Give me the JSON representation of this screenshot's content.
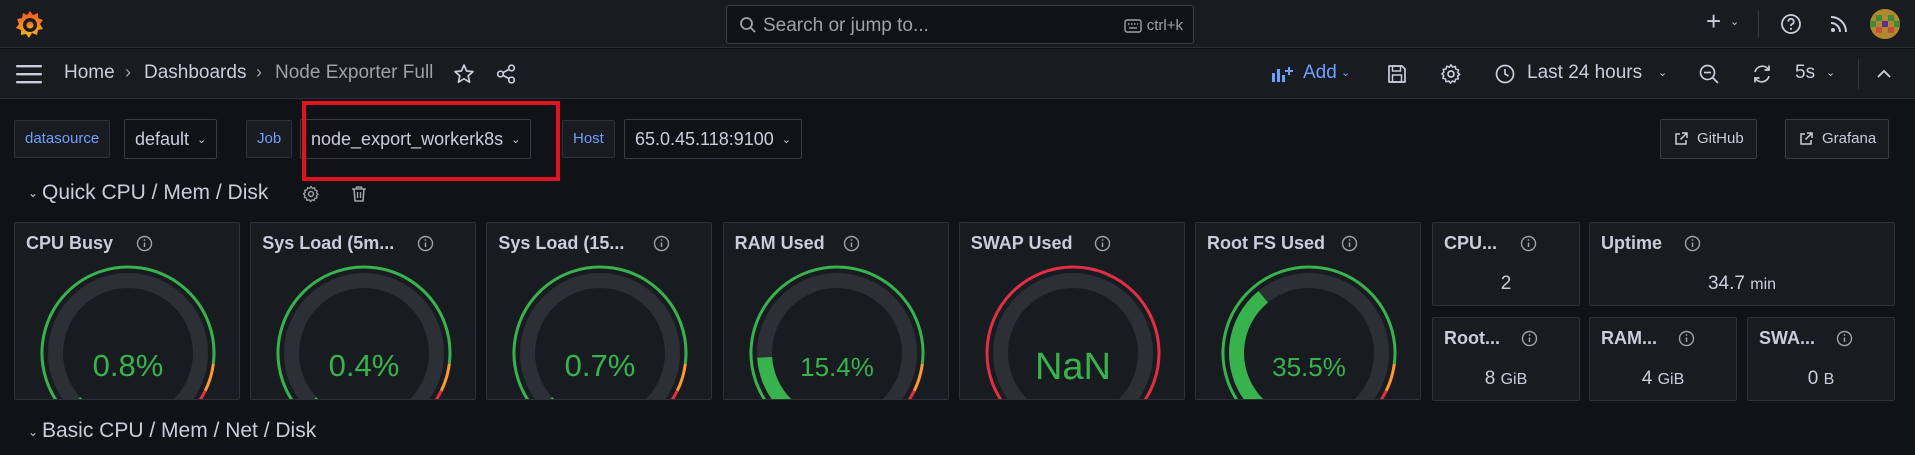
{
  "topbar": {
    "search_placeholder": "Search or jump to...",
    "search_shortcut": "ctrl+k",
    "add_icon_label": "+"
  },
  "nav": {
    "breadcrumbs": [
      "Home",
      "Dashboards",
      "Node Exporter Full"
    ],
    "add_label": "Add",
    "time_range": "Last 24 hours",
    "refresh_interval": "5s"
  },
  "variables": [
    {
      "label": "datasource",
      "value": "default"
    },
    {
      "label": "Job",
      "value": "node_export_workerk8s"
    },
    {
      "label": "Host",
      "value": "65.0.45.118:9100"
    }
  ],
  "links": [
    "GitHub",
    "Grafana"
  ],
  "rows": [
    "Quick CPU / Mem / Disk",
    "Basic CPU / Mem / Net / Disk"
  ],
  "gauges": [
    {
      "title": "CPU Busy",
      "value": "0.8%",
      "fraction": 0.008,
      "arc_color": "#37872d"
    },
    {
      "title": "Sys Load (5m...",
      "value": "0.4%",
      "fraction": 0.004,
      "arc_color": "#37872d"
    },
    {
      "title": "Sys Load (15...",
      "value": "0.7%",
      "fraction": 0.007,
      "arc_color": "#37872d"
    },
    {
      "title": "RAM Used",
      "value": "15.4%",
      "fraction": 0.154,
      "arc_color": "#37872d"
    },
    {
      "title": "SWAP Used",
      "value": "NaN",
      "fraction": 0,
      "arc_color": "#e02f44"
    },
    {
      "title": "Root FS Used",
      "value": "35.5%",
      "fraction": 0.355,
      "arc_color": "#37872d"
    }
  ],
  "stats": {
    "cpu_cores": {
      "title": "CPU...",
      "value": "2",
      "unit": ""
    },
    "uptime": {
      "title": "Uptime",
      "value": "34.7",
      "unit": "min"
    },
    "rootfs_total": {
      "title": "Root...",
      "value": "8",
      "unit": "GiB"
    },
    "ram_total": {
      "title": "RAM...",
      "value": "4",
      "unit": "GiB"
    },
    "swap_total": {
      "title": "SWA...",
      "value": "0",
      "unit": "B"
    }
  },
  "colors": {
    "value_green": "#37b24d",
    "threshold_green": "#37b24d",
    "threshold_orange": "#ff9830",
    "threshold_red": "#e02f44",
    "link_blue": "#6e9fff",
    "highlight": "#e0141e"
  }
}
